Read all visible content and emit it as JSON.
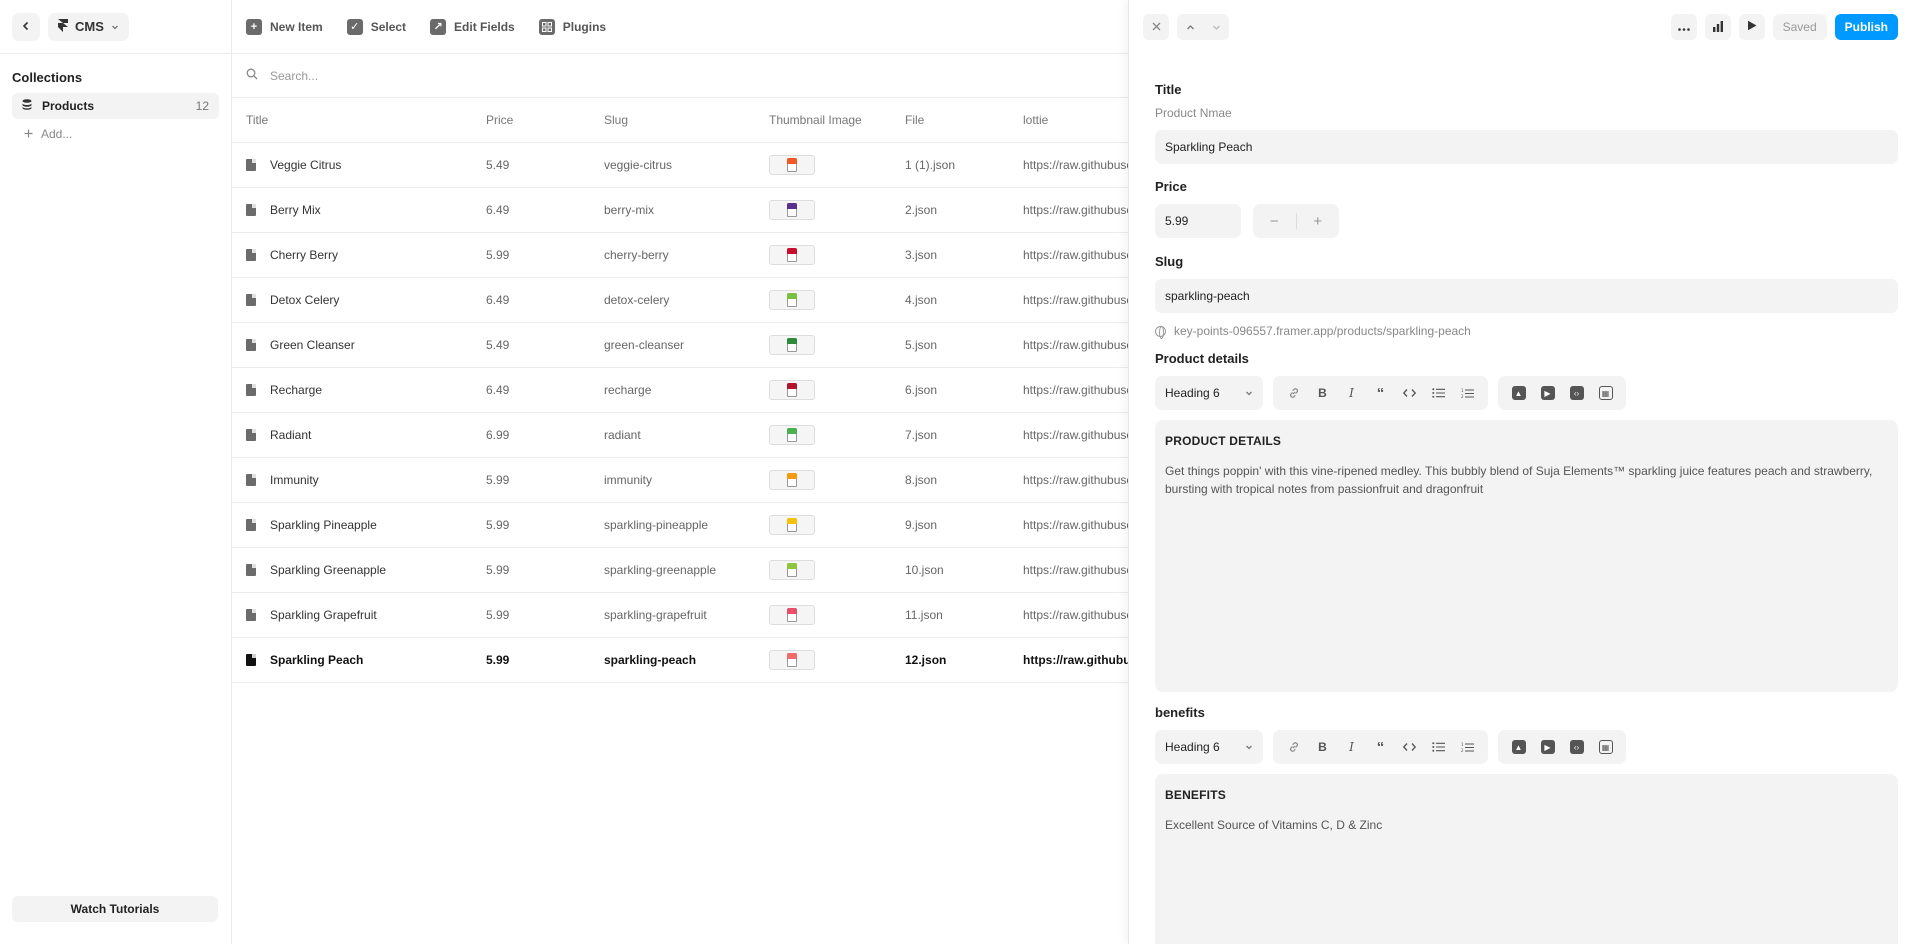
{
  "app": {
    "back_label": "‹",
    "menu_label": "CMS"
  },
  "sidebar": {
    "collections_title": "Collections",
    "items": [
      {
        "label": "Products",
        "count": "12"
      }
    ],
    "add_label": "Add...",
    "watch_tutorials": "Watch Tutorials"
  },
  "toolbar": {
    "new_item": "New Item",
    "select": "Select",
    "edit_fields": "Edit Fields",
    "plugins": "Plugins"
  },
  "search": {
    "placeholder": "Search..."
  },
  "table": {
    "columns": [
      "Title",
      "Price",
      "Slug",
      "Thumbnail Image",
      "File",
      "lottie"
    ],
    "rows": [
      {
        "title": "Veggie Citrus",
        "price": "5.49",
        "slug": "veggie-citrus",
        "file": "1 (1).json",
        "lottie": "https://raw.githubusercontent.com",
        "cap": "#f05a28"
      },
      {
        "title": "Berry Mix",
        "price": "6.49",
        "slug": "berry-mix",
        "file": "2.json",
        "lottie": "https://raw.githubusercontent.com",
        "cap": "#5b2d8e"
      },
      {
        "title": "Cherry Berry",
        "price": "5.99",
        "slug": "cherry-berry",
        "file": "3.json",
        "lottie": "https://raw.githubusercontent.com",
        "cap": "#c8102e"
      },
      {
        "title": "Detox Celery",
        "price": "6.49",
        "slug": "detox-celery",
        "file": "4.json",
        "lottie": "https://raw.githubusercontent.com",
        "cap": "#7ac143"
      },
      {
        "title": "Green Cleanser",
        "price": "5.49",
        "slug": "green-cleanser",
        "file": "5.json",
        "lottie": "https://raw.githubusercontent.com",
        "cap": "#2e8b3a"
      },
      {
        "title": "Recharge",
        "price": "6.49",
        "slug": "recharge",
        "file": "6.json",
        "lottie": "https://raw.githubusercontent.com",
        "cap": "#b5122b"
      },
      {
        "title": "Radiant",
        "price": "6.99",
        "slug": "radiant",
        "file": "7.json",
        "lottie": "https://raw.githubusercontent.com",
        "cap": "#4caf50"
      },
      {
        "title": "Immunity",
        "price": "5.99",
        "slug": "immunity",
        "file": "8.json",
        "lottie": "https://raw.githubusercontent.com",
        "cap": "#f39c12"
      },
      {
        "title": "Sparkling Pineapple",
        "price": "5.99",
        "slug": "sparkling-pineapple",
        "file": "9.json",
        "lottie": "https://raw.githubusercontent.com",
        "cap": "#f4c20d"
      },
      {
        "title": "Sparkling Greenapple",
        "price": "5.99",
        "slug": "sparkling-greenapple",
        "file": "10.json",
        "lottie": "https://raw.githubusercontent.com",
        "cap": "#8dc63f"
      },
      {
        "title": "Sparkling Grapefruit",
        "price": "5.99",
        "slug": "sparkling-grapefruit",
        "file": "11.json",
        "lottie": "https://raw.githubusercontent.com",
        "cap": "#e94e6b"
      },
      {
        "title": "Sparkling Peach",
        "price": "5.99",
        "slug": "sparkling-peach",
        "file": "12.json",
        "lottie": "https://raw.githubusercontent.com",
        "cap": "#f26b6b",
        "selected": true
      }
    ]
  },
  "panel": {
    "saved": "Saved",
    "publish": "Publish",
    "title_label": "Title",
    "title_sub": "Product Nmae",
    "title_value": "Sparkling Peach",
    "price_label": "Price",
    "price_value": "5.99",
    "minus": "−",
    "plus": "+",
    "slug_label": "Slug",
    "slug_value": "sparkling-peach",
    "url": "key-points-096557.framer.app/products/sparkling-peach",
    "details_label": "Product details",
    "heading_select": "Heading 6",
    "details_heading": "PRODUCT DETAILS",
    "details_body": "Get things poppin' with this vine-ripened medley. This bubbly blend of Suja Elements™ sparkling juice features peach and strawberry, bursting with tropical notes from passionfruit and dragonfruit",
    "benefits_label": "benefits",
    "benefits_heading": "BENEFITS",
    "benefits_body": "Excellent Source of Vitamins C, D & Zinc"
  },
  "colors": {
    "accent": "#0099ff"
  }
}
